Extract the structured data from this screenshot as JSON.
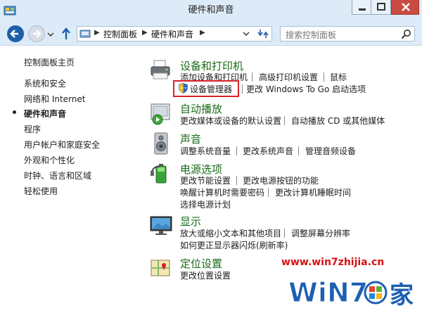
{
  "window": {
    "title": "硬件和声音"
  },
  "address": {
    "crumbs": [
      "控制面板",
      "硬件和声音"
    ]
  },
  "search": {
    "placeholder": "搜索控制面板"
  },
  "nav": {
    "items": [
      {
        "label": "控制面板主页",
        "active": false
      },
      {
        "label": "系统和安全",
        "active": false
      },
      {
        "label": "网络和 Internet",
        "active": false
      },
      {
        "label": "硬件和声音",
        "active": true
      },
      {
        "label": "程序",
        "active": false
      },
      {
        "label": "用户帐户和家庭安全",
        "active": false
      },
      {
        "label": "外观和个性化",
        "active": false
      },
      {
        "label": "时钟、语言和区域",
        "active": false
      },
      {
        "label": "轻松使用",
        "active": false
      }
    ]
  },
  "categories": [
    {
      "title": "设备和打印机",
      "icon": "printer-icon",
      "links": [
        "添加设备和打印机",
        "高级打印机设置",
        "鼠标",
        "设备管理器",
        "更改 Windows To Go 启动选项"
      ]
    },
    {
      "title": "自动播放",
      "icon": "autoplay-icon",
      "links": [
        "更改媒体或设备的默认设置",
        "自动播放 CD 或其他媒体"
      ]
    },
    {
      "title": "声音",
      "icon": "speaker-icon",
      "links": [
        "调整系统音量",
        "更改系统声音",
        "管理音频设备"
      ]
    },
    {
      "title": "电源选项",
      "icon": "battery-icon",
      "links": [
        "更改节能设置",
        "更改电源按钮的功能",
        "唤醒计算机时需要密码",
        "更改计算机睡眠时间",
        "选择电源计划"
      ]
    },
    {
      "title": "显示",
      "icon": "monitor-icon",
      "links": [
        "放大或缩小文本和其他项目",
        "调整屏幕分辨率",
        "如何更正显示器闪烁(刷新率)"
      ]
    },
    {
      "title": "定位设置",
      "icon": "map-icon",
      "links": [
        "更改位置设置"
      ]
    }
  ],
  "highlight": {
    "color": "#d9202a"
  },
  "colors": {
    "category_title": "#1a6a1a",
    "chrome": "#dcebf7"
  },
  "watermark": {
    "url": "www.win7zhijia.cn",
    "logo_text": "WIN7之家"
  }
}
